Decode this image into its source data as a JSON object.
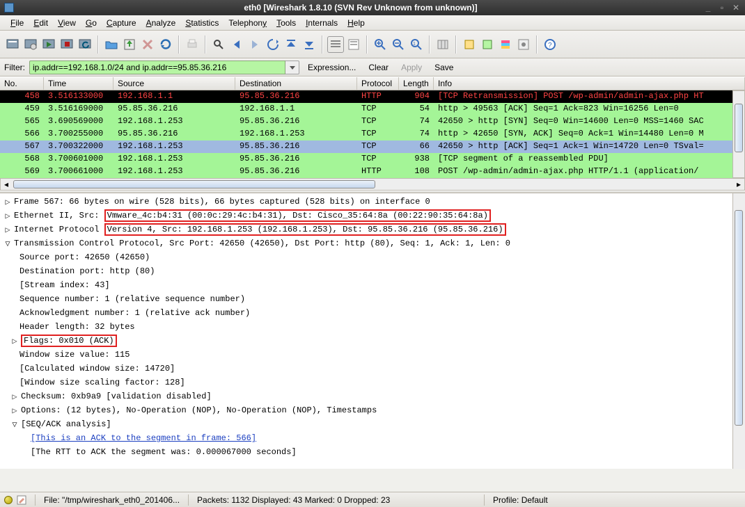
{
  "window_title": "eth0   [Wireshark 1.8.10  (SVN Rev Unknown from unknown)]",
  "menu": {
    "file": "File",
    "edit": "Edit",
    "view": "View",
    "go": "Go",
    "capture": "Capture",
    "analyze": "Analyze",
    "statistics": "Statistics",
    "telephony": "Telephony",
    "tools": "Tools",
    "internals": "Internals",
    "help": "Help"
  },
  "filter": {
    "label": "Filter:",
    "value": "ip.addr==192.168.1.0/24 and ip.addr==95.85.36.216",
    "expression": "Expression...",
    "clear": "Clear",
    "apply": "Apply",
    "save": "Save"
  },
  "columns": {
    "no": "No.",
    "time": "Time",
    "src": "Source",
    "dst": "Destination",
    "proto": "Protocol",
    "len": "Length",
    "info": "Info"
  },
  "packets": [
    {
      "no": "458",
      "time": "3.516133000",
      "src": "192.168.1.1",
      "dst": "95.85.36.216",
      "proto": "HTTP",
      "len": "904",
      "info": "[TCP Retransmission] POST /wp-admin/admin-ajax.php HT",
      "style": "black"
    },
    {
      "no": "459",
      "time": "3.516169000",
      "src": "95.85.36.216",
      "dst": "192.168.1.1",
      "proto": "TCP",
      "len": "54",
      "info": "http > 49563 [ACK] Seq=1 Ack=823 Win=16256 Len=0",
      "style": "green"
    },
    {
      "no": "565",
      "time": "3.690569000",
      "src": "192.168.1.253",
      "dst": "95.85.36.216",
      "proto": "TCP",
      "len": "74",
      "info": "42650 > http [SYN] Seq=0 Win=14600 Len=0 MSS=1460 SAC",
      "style": "green"
    },
    {
      "no": "566",
      "time": "3.700255000",
      "src": "95.85.36.216",
      "dst": "192.168.1.253",
      "proto": "TCP",
      "len": "74",
      "info": "http > 42650 [SYN, ACK] Seq=0 Ack=1 Win=14480 Len=0 M",
      "style": "green"
    },
    {
      "no": "567",
      "time": "3.700322000",
      "src": "192.168.1.253",
      "dst": "95.85.36.216",
      "proto": "TCP",
      "len": "66",
      "info": "42650 > http [ACK] Seq=1 Ack=1 Win=14720 Len=0 TSval=",
      "style": "blue-sel"
    },
    {
      "no": "568",
      "time": "3.700601000",
      "src": "192.168.1.253",
      "dst": "95.85.36.216",
      "proto": "TCP",
      "len": "938",
      "info": "[TCP segment of a reassembled PDU]",
      "style": "green"
    },
    {
      "no": "569",
      "time": "3.700661000",
      "src": "192.168.1.253",
      "dst": "95.85.36.216",
      "proto": "HTTP",
      "len": "108",
      "info": "POST /wp-admin/admin-ajax.php HTTP/1.1  (application/",
      "style": "green"
    }
  ],
  "tree": {
    "frame": "Frame 567: 66 bytes on wire (528 bits), 66 bytes captured (528 bits) on interface 0",
    "eth_pre": "Ethernet II, Src: ",
    "eth_red": "Vmware_4c:b4:31 (00:0c:29:4c:b4:31), Dst: Cisco_35:64:8a (00:22:90:35:64:8a)",
    "ip_pre": "Internet Protocol ",
    "ip_red": "Version 4, Src: 192.168.1.253 (192.168.1.253), Dst: 95.85.36.216 (95.85.36.216)",
    "tcp": "Transmission Control Protocol, Src Port: 42650 (42650), Dst Port: http (80), Seq: 1, Ack: 1, Len: 0",
    "srcport": "Source port: 42650 (42650)",
    "dstport": "Destination port: http (80)",
    "sidx": "[Stream index: 43]",
    "seq": "Sequence number: 1    (relative sequence number)",
    "ack": "Acknowledgment number: 1    (relative ack number)",
    "hdrlen": "Header length: 32 bytes",
    "flags": "Flags: 0x010 (ACK)",
    "win": "Window size value: 115",
    "calcwin": "[Calculated window size: 14720]",
    "scale": "[Window size scaling factor: 128]",
    "chksum": "Checksum: 0xb9a9 [validation disabled]",
    "opts": "Options: (12 bytes), No-Operation (NOP), No-Operation (NOP), Timestamps",
    "seqack": "[SEQ/ACK analysis]",
    "seqack_link": "[This is an ACK to the segment in frame: 566]",
    "rtt": "[The RTT to ACK the segment was: 0.000067000 seconds]"
  },
  "status": {
    "file": "File: \"/tmp/wireshark_eth0_201406...",
    "counts": "Packets: 1132 Displayed: 43 Marked: 0 Dropped: 23",
    "profile": "Profile: Default"
  }
}
